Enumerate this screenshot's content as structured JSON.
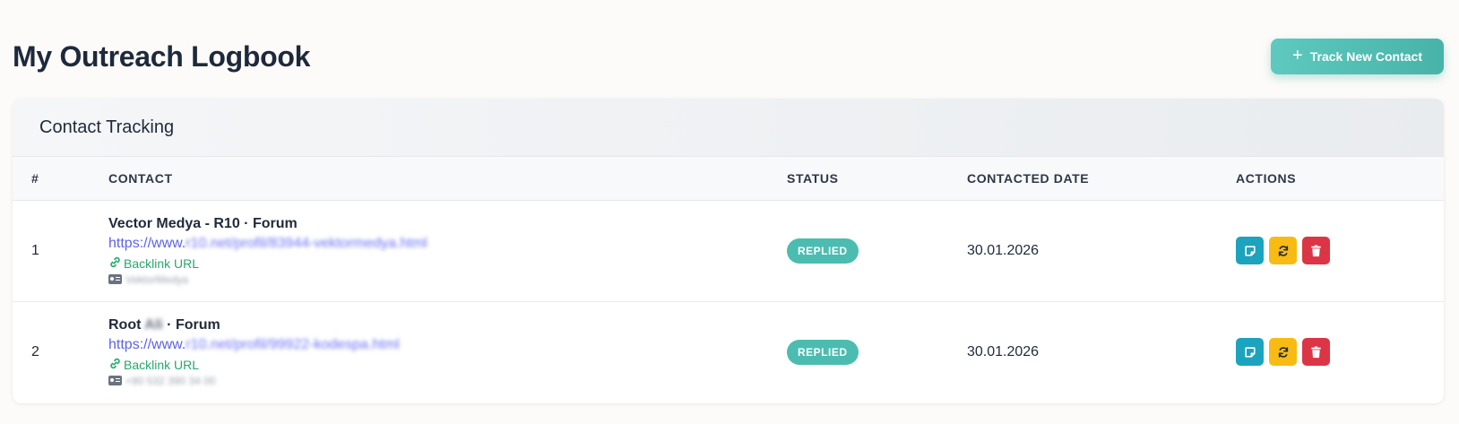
{
  "page": {
    "title": "My Outreach Logbook",
    "track_button": {
      "icon": "plus-icon",
      "label": "Track New Contact"
    }
  },
  "card": {
    "title": "Contact Tracking"
  },
  "table": {
    "columns": [
      "#",
      "CONTACT",
      "STATUS",
      "CONTACTED DATE",
      "ACTIONS"
    ],
    "rows": [
      {
        "num": "1",
        "name_prefix": "Vector Medya - R10 · Forum",
        "name_blur": "",
        "name_suffix": "",
        "url_visible": "https://www.",
        "url_blurred": "r10.net/profil/83944-vektormedya.html",
        "backlink_label": "Backlink URL",
        "meta": "VektorMedya",
        "status": "REPLIED",
        "date": "30.01.2026"
      },
      {
        "num": "2",
        "name_prefix": "Root ",
        "name_blur": "Ali",
        "name_suffix": " · Forum",
        "url_visible": "https://www.",
        "url_blurred": "r10.net/profil/99922-kodespa.html",
        "backlink_label": "Backlink URL",
        "meta": "+90 532 390 34 00",
        "status": "REPLIED",
        "date": "30.01.2026"
      }
    ]
  },
  "colors": {
    "accent": "#4cbcb1",
    "note_button": "#1ca3bd",
    "sync_button": "#f8bb14",
    "delete_button": "#dc3545",
    "link": "#5b61f0",
    "backlink": "#26a96c"
  },
  "icons": {
    "note": "note-icon",
    "sync": "sync-icon",
    "delete": "trash-icon",
    "backlink": "link-icon",
    "meta": "id-card-icon"
  }
}
